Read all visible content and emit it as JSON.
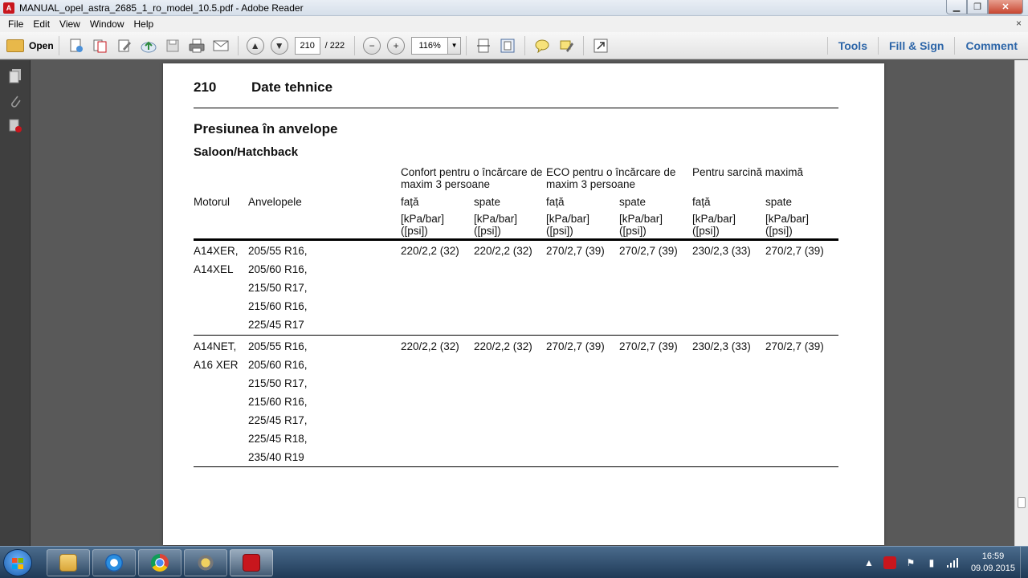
{
  "window": {
    "title": "MANUAL_opel_astra_2685_1_ro_model_10.5.pdf - Adobe Reader",
    "minimize": "▁",
    "maximize": "❐",
    "close": "✕"
  },
  "menu": {
    "items": [
      "File",
      "Edit",
      "View",
      "Window",
      "Help"
    ],
    "close": "×"
  },
  "toolbar": {
    "open_label": "Open",
    "page_current": "210",
    "page_total": "/ 222",
    "zoom_value": "116%",
    "zoom_minus": "−",
    "zoom_plus": "+",
    "prev_page": "▲",
    "next_page": "▼",
    "right_buttons": [
      "Tools",
      "Fill & Sign",
      "Comment"
    ]
  },
  "page": {
    "number": "210",
    "chapter": "Date tehnice",
    "section_title": "Presiunea în anvelope",
    "subsection": "Saloon/Hatchback",
    "col_engine": "Motorul",
    "col_tyres": "Anvelopele",
    "groups": [
      "Confort pentru o încărcare de maxim 3 persoane",
      "ECO pentru o încărcare de maxim 3 persoane",
      "Pentru sarcină maximă"
    ],
    "front": "față",
    "rear": "spate",
    "unit": "[kPa/bar] ([psi])",
    "rows": [
      {
        "engine": [
          "A14XER,",
          "A14XEL"
        ],
        "tyres": [
          "205/55 R16,",
          "205/60 R16,",
          "215/50 R17,",
          "215/60 R16,",
          "225/45 R17"
        ],
        "values": [
          "220/2,2 (32)",
          "220/2,2 (32)",
          "270/2,7 (39)",
          "270/2,7 (39)",
          "230/2,3 (33)",
          "270/2,7 (39)"
        ]
      },
      {
        "engine": [
          "A14NET,",
          "A16 XER"
        ],
        "tyres": [
          "205/55 R16,",
          "205/60 R16,",
          "215/50 R17,",
          "215/60 R16,",
          "225/45 R17,",
          "225/45 R18,",
          "235/40 R19"
        ],
        "values": [
          "220/2,2 (32)",
          "220/2,2 (32)",
          "270/2,7 (39)",
          "270/2,7 (39)",
          "230/2,3 (33)",
          "270/2,7 (39)"
        ]
      }
    ]
  },
  "taskbar": {
    "time": "16:59",
    "date": "09.09.2015"
  },
  "colors": {
    "accent": "#2c65a8",
    "reader_red": "#c8161d"
  }
}
